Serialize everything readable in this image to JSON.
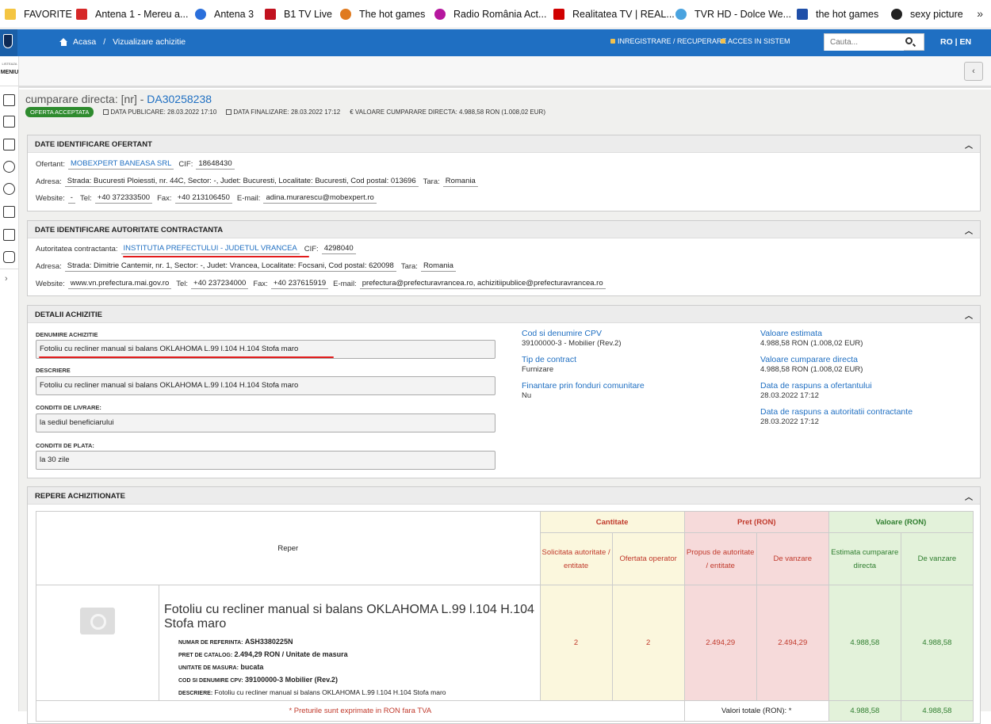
{
  "bookmarks": [
    {
      "label": "FAVORITE",
      "color": "#f4c542",
      "icon": "folder-icon"
    },
    {
      "label": "Antena 1 - Mereu a...",
      "color": "#d62828",
      "icon": "antena1-icon"
    },
    {
      "label": "Antena 3",
      "color": "#2a6fdb",
      "icon": "antena3-icon"
    },
    {
      "label": "B1 TV Live",
      "color": "#c1121f",
      "icon": "b1tv-icon"
    },
    {
      "label": "The hot games",
      "color": "#e07a1f",
      "icon": "hotgames-icon"
    },
    {
      "label": "Radio România Act...",
      "color": "#b5179e",
      "icon": "radio-romania-icon"
    },
    {
      "label": "Realitatea TV | REAL...",
      "color": "#d00000",
      "icon": "realitatea-icon"
    },
    {
      "label": "TVR HD - Dolce We...",
      "color": "#4aa3df",
      "icon": "tvr-icon"
    },
    {
      "label": "the hot games",
      "color": "#1f4fa8",
      "icon": "hotgames2-icon"
    },
    {
      "label": "sexy picture",
      "color": "#222222",
      "icon": "globe-icon"
    }
  ],
  "topnav": {
    "home": "Acasa",
    "sep": "/",
    "page": "Vizualizare achizitie",
    "register": "INREGISTRARE / RECUPERARE",
    "login": "ACCES IN SISTEM",
    "search_placeholder": "Cauta...",
    "lang": "RO | EN"
  },
  "sidebar": {
    "small": "LISTEAZA",
    "big": "MENIU"
  },
  "header": {
    "title_prefix": "cumparare directa: [nr] - ",
    "title_id": "DA30258238",
    "badge": "OFERTA ACCEPTATA",
    "publish": "DATA PUBLICARE: 28.03.2022 17:10",
    "finish": "DATA FINALIZARE: 28.03.2022 17:12",
    "value": "€ VALOARE CUMPARARE DIRECTA: 4.988,58  RON (1.008,02  EUR)"
  },
  "ofertant": {
    "heading": "DATE IDENTIFICARE OFERTANT",
    "l_ofertant": "Ofertant:",
    "ofertant": "MOBEXPERT BANEASA SRL",
    "l_cif": "CIF:",
    "cif": "18648430",
    "l_adresa": "Adresa:",
    "adresa": "Strada: Bucuresti Ploiessti, nr. 44C, Sector: -, Judet: Bucuresti, Localitate: Bucuresti, Cod postal: 013696",
    "l_tara": "Tara:",
    "tara": "Romania",
    "l_website": "Website:",
    "website": "-",
    "l_tel": "Tel:",
    "tel": "+40 372333500",
    "l_fax": "Fax:",
    "fax": "+40 213106450",
    "l_email": "E-mail:",
    "email": "adina.murarescu@mobexpert.ro"
  },
  "autoritate": {
    "heading": "DATE IDENTIFICARE AUTORITATE CONTRACTANTA",
    "l_aut": "Autoritatea contractanta:",
    "aut": "INSTITUTIA PREFECTULUI - JUDETUL VRANCEA",
    "l_cif": "CIF:",
    "cif": "4298040",
    "l_adresa": "Adresa:",
    "adresa": "Strada: Dimitrie Cantemir, nr. 1, Sector: -, Judet: Vrancea, Localitate: Focsani, Cod postal: 620098",
    "l_tara": "Tara:",
    "tara": "Romania",
    "l_website": "Website:",
    "website": "www.vn.prefectura.mai.gov.ro",
    "l_tel": "Tel:",
    "tel": "+40 237234000",
    "l_fax": "Fax:",
    "fax": "+40 237615919",
    "l_email": "E-mail:",
    "email": "prefectura@prefecturavrancea.ro, achizitiipublice@prefecturavrancea.ro"
  },
  "detalii": {
    "heading": "DETALII ACHIZITIE",
    "l_denumire": "DENUMIRE ACHIZITIE",
    "denumire": "Fotoliu cu recliner manual si balans OKLAHOMA L.99 l.104 H.104 Stofa maro",
    "l_descriere": "DESCRIERE",
    "descriere": "Fotoliu cu recliner manual si balans OKLAHOMA L.99 l.104 H.104 Stofa maro",
    "l_livrare": "CONDITII DE LIVRARE:",
    "livrare": "la sediul beneficiarului",
    "l_plata": "CONDITII DE PLATA:",
    "plata": "la 30 zile",
    "cpv_t": "Cod si denumire CPV",
    "cpv_v": "39100000-3 - Mobilier (Rev.2)",
    "tip_t": "Tip de contract",
    "tip_v": "Furnizare",
    "fin_t": "Finantare prin fonduri comunitare",
    "fin_v": "Nu",
    "est_t": "Valoare estimata",
    "est_v": "4.988,58  RON (1.008,02  EUR)",
    "cump_t": "Valoare cumparare directa",
    "cump_v": "4.988,58  RON (1.008,02  EUR)",
    "rasp_of_t": "Data de raspuns a ofertantului",
    "rasp_of_v": "28.03.2022 17:12",
    "rasp_aut_t": "Data de raspuns a autoritatii contractante",
    "rasp_aut_v": "28.03.2022 17:12"
  },
  "repere": {
    "heading": "REPERE ACHIZITIONATE",
    "col_reper": "Reper",
    "col_cant": "Cantitate",
    "col_pret": "Pret (RON)",
    "col_val": "Valoare (RON)",
    "sub_solicitata": "Solicitata autoritate / entitate",
    "sub_oferta": "Ofertata operator",
    "sub_propus": "Propus de autoritate / entitate",
    "sub_vanzare": "De vanzare",
    "sub_estimata": "Estimata cumparare directa",
    "sub_vanzare2": "De vanzare",
    "item": {
      "name": "Fotoliu cu recliner manual si balans OKLAHOMA L.99 l.104 H.104 Stofa maro",
      "k_ref": "NUMAR DE REFERINTA:",
      "v_ref": "ASH3380225N",
      "k_pret": "PRET DE CATALOG:",
      "v_pret": "2.494,29  RON / Unitate de masura",
      "k_um": "UNITATE DE MASURA:",
      "v_um": "bucata",
      "k_cpv": "COD SI DENUMIRE CPV:",
      "v_cpv": "39100000-3 Mobilier (Rev.2)",
      "k_desc": "DESCRIERE:",
      "v_desc": "Fotoliu cu recliner manual si balans OKLAHOMA L.99 l.104 H.104 Stofa maro",
      "solicitata": "2",
      "oferta": "2",
      "propus": "2.494,29",
      "vanzare": "2.494,29",
      "estimata": "4.988,58",
      "vanzare_val": "4.988,58"
    },
    "note": "* Preturile sunt exprimate in RON fara TVA",
    "totals_label": "Valori totale (RON): *",
    "total_est": "4.988,58",
    "total_vanz": "4.988,58"
  },
  "colors": {
    "nav_blue": "#1f6fc2",
    "accent_red": "#e21b1b",
    "badge_green": "#2e8b2e"
  }
}
